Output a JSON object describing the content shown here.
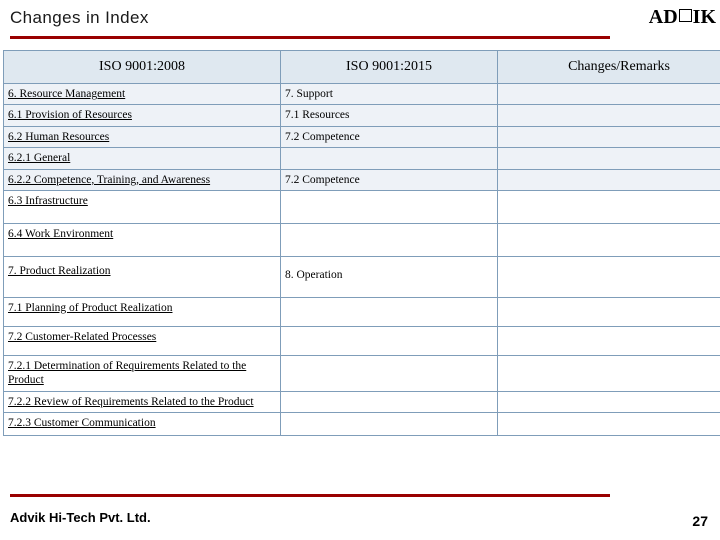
{
  "header": {
    "title": "Changes in Index",
    "logo_left": "AD",
    "logo_right": "IK"
  },
  "footer": {
    "company": "Advik Hi-Tech Pvt. Ltd.",
    "page_number": "27"
  },
  "table": {
    "columns": [
      "ISO 9001:2008",
      "ISO 9001:2015",
      "Changes/Remarks"
    ],
    "rows": [
      {
        "c1": "6. Resource Management",
        "c2": "7. Support",
        "c3": ""
      },
      {
        "c1": "6.1 Provision of Resources",
        "c2": "7.1 Resources",
        "c3": ""
      },
      {
        "c1": "6.2 Human Resources",
        "c2": "7.2 Competence",
        "c3": ""
      },
      {
        "c1": "6.2.1 General",
        "c2": "",
        "c3": ""
      },
      {
        "c1": "6.2.2 Competence, Training, and Awareness",
        "c2": "7.2 Competence",
        "c3": ""
      },
      {
        "c1": "6.3 Infrastructure",
        "c2": "",
        "c3": ""
      },
      {
        "c1": "6.4 Work Environment",
        "c2": "",
        "c3": ""
      },
      {
        "c1": "7. Product Realization",
        "c2": "8. Operation",
        "c3": ""
      },
      {
        "c1": "7.1 Planning of Product Realization",
        "c2": "",
        "c3": ""
      },
      {
        "c1": "7.2 Customer-Related Processes",
        "c2": "",
        "c3": ""
      },
      {
        "c1": "7.2.1 Determination of Requirements Related to the Product",
        "c2": "",
        "c3": ""
      },
      {
        "c1": "7.2.2 Review of Requirements Related to the Product",
        "c2": "",
        "c3": ""
      },
      {
        "c1": "7.2.3 Customer Communication",
        "c2": "",
        "c3": ""
      }
    ]
  },
  "colors": {
    "rule": "#990000",
    "header_fill": "#dfe8f0",
    "row_shade": "#eef2f7",
    "border": "#7f9db9"
  }
}
